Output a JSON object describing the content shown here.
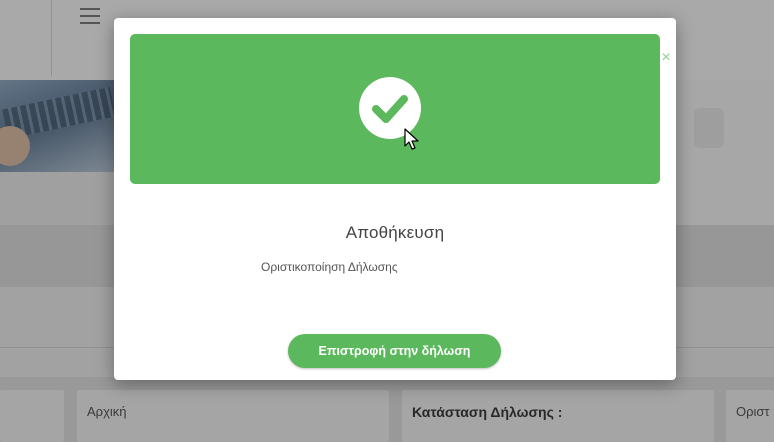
{
  "background": {
    "cards": [
      {
        "label": ""
      },
      {
        "label": "Αρχική"
      },
      {
        "label": "Κατάσταση Δήλωσης :"
      },
      {
        "label": "Οριστ"
      }
    ]
  },
  "modal": {
    "title": "Αποθήκευση",
    "subtitle": "Οριστικοποίηση Δήλωσης",
    "return_button_label": "Επιστροφή στην δήλωση",
    "close_symbol": "×",
    "status_icon": "check-circle-icon",
    "accent_color": "#5cb85c"
  }
}
